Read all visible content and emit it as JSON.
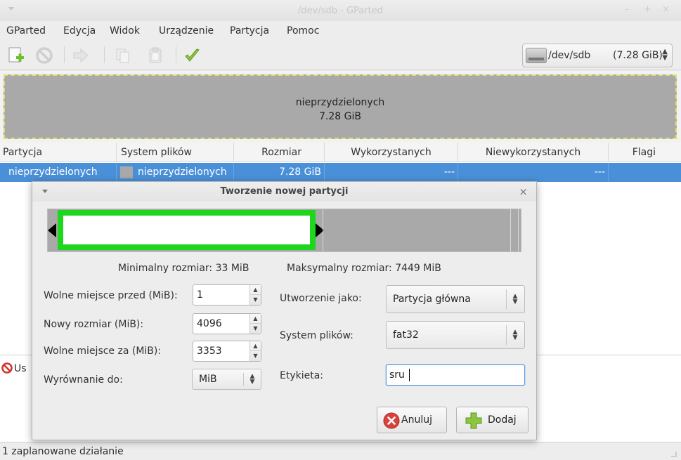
{
  "window": {
    "title": "/dev/sdb - GParted",
    "minimize": "–",
    "maximize": "+",
    "close": "×"
  },
  "menubar": [
    "GParted",
    "Edycja",
    "Widok",
    "Urządzenie",
    "Partycja",
    "Pomoc"
  ],
  "toolbar": {
    "device": {
      "name": "/dev/sdb",
      "size": "(7.28 GiB)"
    }
  },
  "disk_map": {
    "label": "nieprzydzielonych",
    "size": "7.28 GiB"
  },
  "table": {
    "headers": [
      "Partycja",
      "System plików",
      "Rozmiar",
      "Wykorzystanych",
      "Niewykorzystanych",
      "Flagi"
    ],
    "row": {
      "partition": "nieprzydzielonych",
      "filesystem": "nieprzydzielonych",
      "size": "7.28 GiB",
      "used": "---",
      "unused": "---",
      "flags": ""
    }
  },
  "pending": {
    "text": "Us"
  },
  "statusbar": {
    "text": "1 zaplanowane działanie"
  },
  "dialog": {
    "title": "Tworzenie nowej partycji",
    "close": "×",
    "min_size": "Minimalny rozmiar: 33 MiB",
    "max_size": "Maksymalny rozmiar: 7449 MiB",
    "free_before": {
      "label": "Wolne miejsce przed (MiB):",
      "value": "1"
    },
    "new_size": {
      "label": "Nowy rozmiar (MiB):",
      "value": "4096"
    },
    "free_after": {
      "label": "Wolne miejsce za (MiB):",
      "value": "3353"
    },
    "align": {
      "label": "Wyrównanie do:",
      "value": "MiB"
    },
    "create_as": {
      "label": "Utworzenie jako:",
      "value": "Partycja główna"
    },
    "filesystem": {
      "label": "System plików:",
      "value": "fat32"
    },
    "label": {
      "label": "Etykieta:",
      "value": "sru"
    },
    "cancel": "Anuluj",
    "add": "Dodaj"
  },
  "colors": {
    "selection": "#4a90d9",
    "unallocated": "#a9a9a9",
    "partition_border": "#1ed61e",
    "dashed_border": "#e0dd70"
  }
}
